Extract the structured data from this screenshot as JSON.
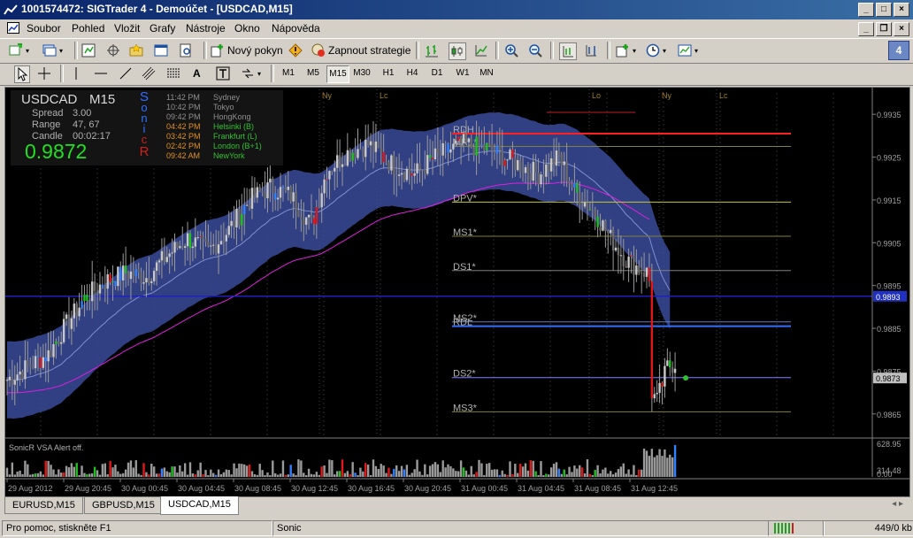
{
  "window": {
    "title": "1001574472: SIGTrader 4 - Demoúčet - [USDCAD,M15]"
  },
  "menu": [
    "Soubor",
    "Pohled",
    "Vložit",
    "Grafy",
    "Nástroje",
    "Okno",
    "Nápověda"
  ],
  "toolbar": {
    "new_order": "Nový pokyn",
    "start_strategy": "Zapnout strategie"
  },
  "timeframes": [
    "M1",
    "M5",
    "M15",
    "M30",
    "H1",
    "H4",
    "D1",
    "W1",
    "MN"
  ],
  "active_timeframe": "M15",
  "panel_count": "4",
  "chart": {
    "symbol": "USDCAD",
    "tf": "M15",
    "spread_label": "Spread",
    "spread": "3.00",
    "range_label": "Range",
    "range": "47, 67",
    "candle_label": "Candle",
    "candle": "00:02:17",
    "price": "0.9872",
    "brand_letters": [
      "S",
      "o",
      "n",
      "i",
      "c",
      "R"
    ],
    "sessions": [
      {
        "time": "11:42 PM",
        "name": "Sydney",
        "active": false
      },
      {
        "time": "10:42 PM",
        "name": "Tokyo",
        "active": false
      },
      {
        "time": "09:42 PM",
        "name": "HongKong",
        "active": false
      },
      {
        "time": "04:42 PM",
        "name": "Helsinki  (B)",
        "active": true
      },
      {
        "time": "03:42 PM",
        "name": "Frankfurt  (L)",
        "active": true
      },
      {
        "time": "02:42 PM",
        "name": "London  (B+1)",
        "active": true
      },
      {
        "time": "09:42 AM",
        "name": "NewYork",
        "active": true
      }
    ],
    "session_markers": [
      "Ny",
      "Lc",
      "Lo",
      "Ny",
      "Lc"
    ],
    "levels": [
      {
        "label": "RDH",
        "price": 0.99305,
        "color": "#ff2020"
      },
      {
        "label": "MR1*",
        "price": 0.99275,
        "color": "#808040"
      },
      {
        "label": "DPV*",
        "price": 0.99145,
        "color": "#c8c830"
      },
      {
        "label": "MS1*",
        "price": 0.99065,
        "color": "#808040"
      },
      {
        "label": "DS1*",
        "price": 0.98985,
        "color": "#808080"
      },
      {
        "label": "MS2*",
        "price": 0.98865,
        "color": "#6080c0"
      },
      {
        "label": "RDL",
        "price": 0.98855,
        "color": "#3070ff"
      },
      {
        "label": "DS2*",
        "price": 0.98735,
        "color": "#8080ff"
      },
      {
        "label": "MS3*",
        "price": 0.98655,
        "color": "#808040"
      }
    ],
    "h_line_price": 0.98925,
    "y_axis": [
      "0.9935",
      "0.9925",
      "0.9915",
      "0.9905",
      "0.9895",
      "0.9885",
      "0.9875",
      "0.9865"
    ],
    "price_tag_blue": "0.9893",
    "price_tag_current": "0.9873",
    "volume_label": "SonicR VSA    Alert off.",
    "volume_axis": [
      "628.95",
      "314.48",
      "0.00"
    ],
    "x_axis": [
      "29 Aug 2012",
      "29 Aug 20:45",
      "30 Aug 00:45",
      "30 Aug 04:45",
      "30 Aug 08:45",
      "30 Aug 12:45",
      "30 Aug 16:45",
      "30 Aug 20:45",
      "31 Aug 00:45",
      "31 Aug 04:45",
      "31 Aug 08:45",
      "31 Aug 12:45"
    ]
  },
  "chart_data": {
    "type": "candlestick",
    "symbol": "USDCAD",
    "timeframe": "M15",
    "ylim": [
      0.986,
      0.994
    ],
    "anchors": [
      [
        0,
        0.9873
      ],
      [
        8,
        0.9876
      ],
      [
        16,
        0.9879
      ],
      [
        22,
        0.9885
      ],
      [
        30,
        0.9892
      ],
      [
        38,
        0.9896
      ],
      [
        46,
        0.9898
      ],
      [
        54,
        0.9897
      ],
      [
        62,
        0.9902
      ],
      [
        70,
        0.9906
      ],
      [
        78,
        0.9903
      ],
      [
        86,
        0.9908
      ],
      [
        94,
        0.9915
      ],
      [
        102,
        0.9918
      ],
      [
        110,
        0.9916
      ],
      [
        118,
        0.9909
      ],
      [
        124,
        0.9922
      ],
      [
        132,
        0.9926
      ],
      [
        140,
        0.9928
      ],
      [
        150,
        0.9923
      ],
      [
        158,
        0.9921
      ],
      [
        166,
        0.9925
      ],
      [
        176,
        0.9928
      ],
      [
        186,
        0.9927
      ],
      [
        196,
        0.9924
      ],
      [
        206,
        0.9921
      ],
      [
        214,
        0.9925
      ],
      [
        220,
        0.9917
      ],
      [
        228,
        0.9912
      ],
      [
        234,
        0.9906
      ],
      [
        240,
        0.9901
      ],
      [
        248,
        0.9898
      ],
      [
        249,
        0.9896
      ],
      [
        250,
        0.987
      ],
      [
        252,
        0.9868
      ],
      [
        256,
        0.9876
      ],
      [
        259,
        0.9877
      ]
    ],
    "total_bars": 260
  }
}
